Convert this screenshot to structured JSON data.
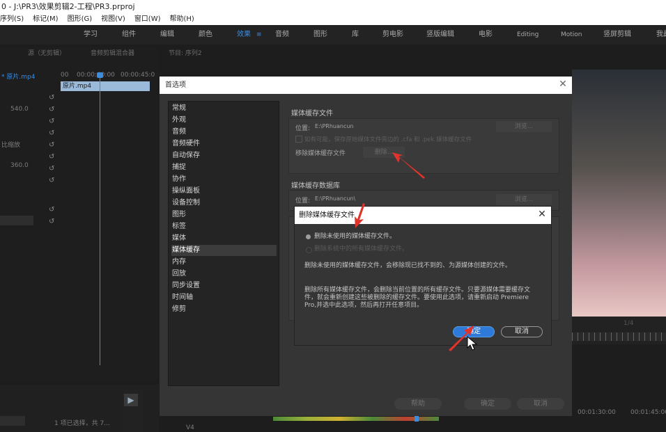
{
  "window": {
    "title": "0 - J:\\PR3\\效果剪辑2-工程\\PR3.prproj",
    "menu": [
      "序列(S)",
      "标记(M)",
      "图形(G)",
      "视图(V)",
      "窗口(W)",
      "帮助(H)"
    ]
  },
  "workspaces": {
    "items": [
      "学习",
      "组件",
      "编辑",
      "颜色",
      "效果",
      "音频",
      "图形",
      "库",
      "剪电影",
      "竖版编辑",
      "电影",
      "Editing",
      "Motion",
      "竖屏剪辑",
      "我最"
    ],
    "active": "效果"
  },
  "background": {
    "panel_tabs": [
      "源（无剪辑）",
      "音频剪辑混合器",
      "节目: 序列2"
    ],
    "source_clip": "* 原片.mp4",
    "timeline_times": [
      "00",
      "00:00:40:00",
      "00:00:45:0"
    ],
    "clip_name": "原片.mp4",
    "effect_values": [
      "540.0",
      "比缩放",
      "360.0"
    ],
    "selection_status": "1 项已选择，共 7...",
    "track_label": "V4",
    "program_times": [
      "00:01:30:00",
      "00:01:45:00"
    ],
    "zoom_fraction": "1/4"
  },
  "prefs": {
    "title": "首选项",
    "categories": [
      "常规",
      "外观",
      "音频",
      "音频硬件",
      "自动保存",
      "捕捉",
      "协作",
      "操纵面板",
      "设备控制",
      "图形",
      "标签",
      "媒体",
      "媒体缓存",
      "内存",
      "回放",
      "同步设置",
      "时间轴",
      "修剪"
    ],
    "selected_category": "媒体缓存",
    "cache_files_title": "媒体缓存文件",
    "location_label": "位置:",
    "cache_location": "E:\\PRhuancun",
    "browse_label": "浏览...",
    "save_next_label": "如有可能，保存原始媒体文件旁边的 .cfa 和 .pek 媒体缓存文件",
    "remove_label": "移除媒体缓存文件",
    "delete_label": "删除...",
    "cache_db_title": "媒体缓存数据库",
    "db_location": "E:\\PRhuancun\\",
    "help_label": "帮助",
    "ok_label": "确定",
    "cancel_label": "取消"
  },
  "delete_dialog": {
    "title": "删除媒体缓存文件",
    "option_unused": "删除未使用的媒体缓存文件。",
    "option_all": "删除系统中的所有媒体缓存文件。",
    "desc_unused": "删除未使用的媒体缓存文件，会移除现已找不到的、为源媒体创建的文件。",
    "desc_all": "删除所有媒体缓存文件，会删除当前位置的所有缓存文件。只要源媒体需要缓存文件，就会重新创建这些被删除的缓存文件。要使用此选项，请重新启动 Premiere Pro,并选中此选项，然后再打开任意项目。",
    "ok_label": "确定",
    "cancel_label": "取消"
  },
  "annotations": {
    "arrow_color": "#e0332b"
  },
  "colors": {
    "accent": "#2e7ad8",
    "active_workspace": "#3d8ce0"
  }
}
